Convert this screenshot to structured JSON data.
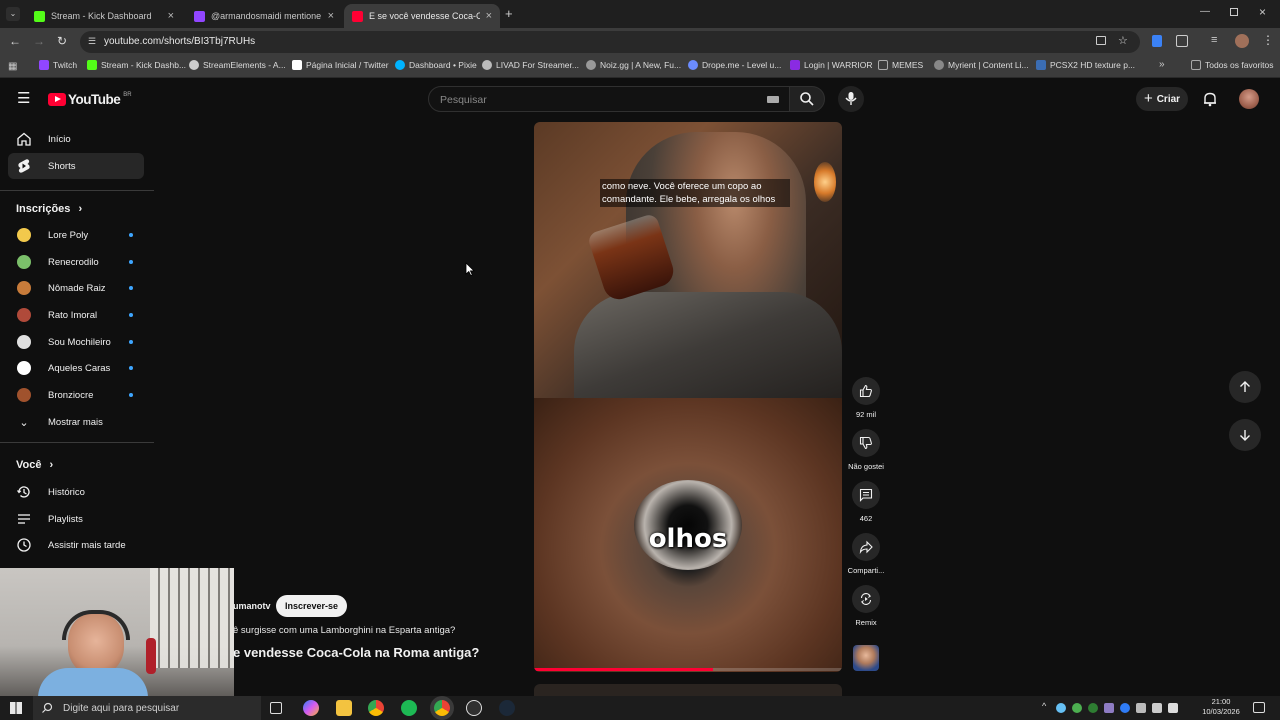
{
  "browser": {
    "tabs": [
      {
        "label": "Stream - Kick Dashboard",
        "color": "#53fc18"
      },
      {
        "label": "@armandosmaidi mentione",
        "color": "#9146ff"
      },
      {
        "label": "E se você vendesse Coca-C",
        "color": "#ff0033"
      }
    ],
    "new_tab": "+",
    "url": "youtube.com/shorts/BI3Tbj7RUHs",
    "bookmarks": [
      {
        "label": "Twitch",
        "color": "#9146ff"
      },
      {
        "label": "Stream - Kick Dashb...",
        "color": "#53fc18"
      },
      {
        "label": "StreamElements - A...",
        "color": "#cccccc"
      },
      {
        "label": "Página Inicial / Twitter",
        "color": "#ffffff"
      },
      {
        "label": "Dashboard • Pixie",
        "color": "#00b3ff"
      },
      {
        "label": "LIVAD For Streamer...",
        "color": "#bbbbbb"
      },
      {
        "label": "Noiz.gg | A New, Fu...",
        "color": "#999999"
      },
      {
        "label": "Drope.me - Level u...",
        "color": "#6b8cff"
      },
      {
        "label": "Login | WARRIOR",
        "color": "#8a2be2"
      },
      {
        "label": "MEMES",
        "color": "#aaaaaa"
      },
      {
        "label": "Myrient | Content Li...",
        "color": "#888888"
      },
      {
        "label": "PCSX2 HD texture p...",
        "color": "#3b6db3"
      }
    ],
    "all_bookmarks": "Todos os favoritos"
  },
  "youtube": {
    "logo": "YouTube",
    "region": "BR",
    "search_placeholder": "Pesquisar",
    "create_label": "Criar"
  },
  "sidebar": {
    "main": [
      {
        "label": "Início",
        "icon": "home-icon"
      },
      {
        "label": "Shorts",
        "icon": "shorts-icon"
      }
    ],
    "subscriptions_title": "Inscrições",
    "subscriptions": [
      {
        "label": "Lore Poly",
        "color": "#f2c94c"
      },
      {
        "label": "Renecrodilo",
        "color": "#7bbf6a"
      },
      {
        "label": "Nômade Raiz",
        "color": "#c77b3a"
      },
      {
        "label": "Rato Imoral",
        "color": "#b04a3a"
      },
      {
        "label": "Sou Mochileiro",
        "color": "#e0e0e0"
      },
      {
        "label": "Aqueles Caras",
        "color": "#ffffff"
      },
      {
        "label": "Bronziocre",
        "color": "#a0522d"
      }
    ],
    "show_more": "Mostrar mais",
    "you_title": "Você",
    "you_items": [
      {
        "label": "Histórico",
        "icon": "history-icon"
      },
      {
        "label": "Playlists",
        "icon": "playlists-icon"
      },
      {
        "label": "Assistir mais tarde",
        "icon": "watch-later-icon"
      }
    ]
  },
  "short": {
    "caption_top": "como neve. Você oferece um copo ao comandante. Ele bebe, arregala os olhos",
    "caption_word": "olhos",
    "progress": 0.58,
    "channel": "umanotv",
    "subscribe": "Inscrever-se",
    "description": "ê surgisse com uma Lamborghini na Esparta antiga?",
    "title": "e vendesse Coca-Cola na Roma antiga?"
  },
  "actions": [
    {
      "label": "92 mil",
      "icon": "like-icon"
    },
    {
      "label": "Não gostei",
      "icon": "dislike-icon"
    },
    {
      "label": "462",
      "icon": "comment-icon"
    },
    {
      "label": "Comparti...",
      "icon": "share-icon"
    },
    {
      "label": "Remix",
      "icon": "remix-icon"
    }
  ],
  "taskbar": {
    "search_placeholder": "Digite aqui para pesquisar",
    "time": "21:00",
    "date": "10/03/2026"
  }
}
